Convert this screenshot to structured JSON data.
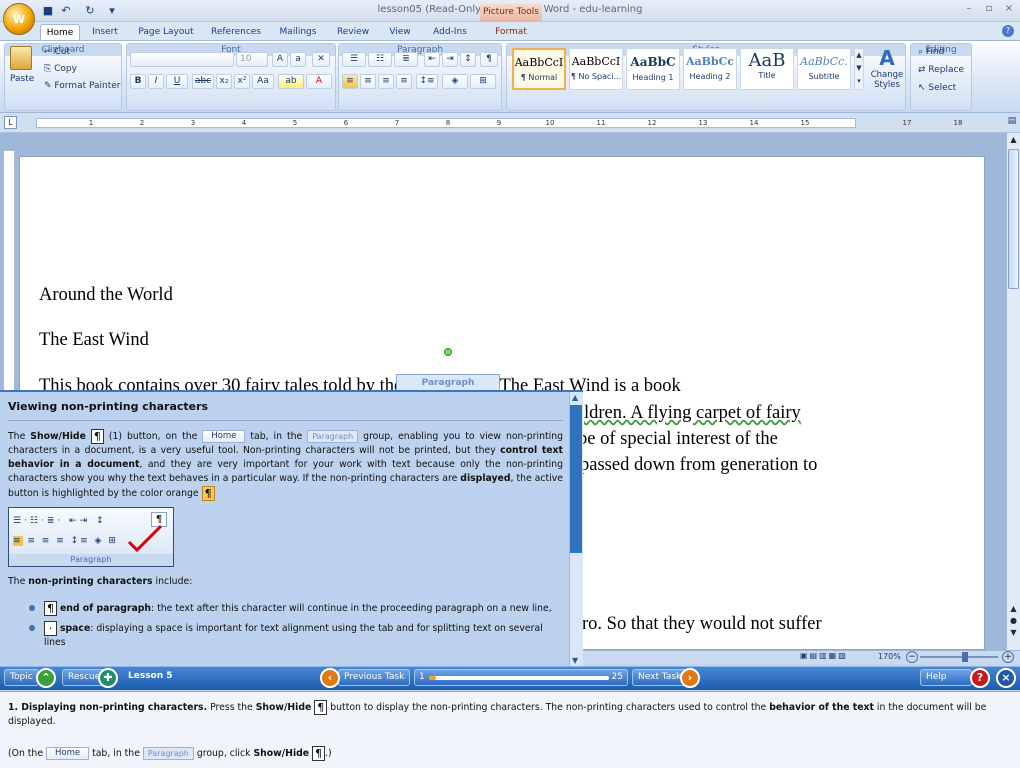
{
  "window": {
    "title": "lesson05 (Read-Only) - Microsoft Word - edu-learning",
    "context_tab": "Picture Tools",
    "office_button": "W"
  },
  "tabs": [
    "Home",
    "Insert",
    "Page Layout",
    "References",
    "Mailings",
    "Review",
    "View",
    "Add-Ins",
    "Format"
  ],
  "ribbon": {
    "clipboard": {
      "label": "Clipboard",
      "paste": "Paste",
      "cut": "Cut",
      "copy": "Copy",
      "format_painter": "Format Painter"
    },
    "font": {
      "label": "Font",
      "size": "10"
    },
    "paragraph": {
      "label": "Paragraph"
    },
    "styles": {
      "label": "Styles",
      "items": [
        {
          "sample": "AaBbCcI",
          "name": "¶ Normal"
        },
        {
          "sample": "AaBbCcI",
          "name": "¶ No Spaci..."
        },
        {
          "sample": "AaBbC",
          "name": "Heading 1"
        },
        {
          "sample": "AaBbCc",
          "name": "Heading 2"
        },
        {
          "sample": "AaB",
          "name": "Title"
        },
        {
          "sample": "AaBbCc.",
          "name": "Subtitle"
        }
      ],
      "change_styles": "Change Styles"
    },
    "editing": {
      "label": "Editing",
      "find": "Find",
      "replace": "Replace",
      "select": "Select"
    }
  },
  "ruler": {
    "ticks": [
      "1",
      "2",
      "3",
      "4",
      "5",
      "6",
      "7",
      "8",
      "9",
      "10",
      "11",
      "12",
      "13",
      "14",
      "15",
      "17",
      "18"
    ]
  },
  "document": {
    "lines": [
      "Around the World",
      "The East Wind",
      "This book contains over 30 fairy tales told by the East Winds. The East Wind is a book",
      "ldren. A flying carpet of fairy",
      "be of special interest of the",
      "passed down from generation to",
      "ro. So that they would not suffer"
    ],
    "float_label": "Paragraph"
  },
  "panel": {
    "title": "Viewing non-printing characters",
    "p1_a": "The ",
    "p1_showhide": "Show/Hide",
    "p1_b": " (1) button, on the ",
    "p1_home": "Home",
    "p1_c": " tab, in the ",
    "p1_paragraph": "Paragraph",
    "p1_d": " group, enabling you to view non-printing characters in a document, is a very useful tool. Non-printing characters will not be printed, but they ",
    "p1_bold1": "control text behavior in a document",
    "p1_e": ", and they are very important for your work with text because only the non-printing characters show you why the text behaves in a particular way. If the non-printing characters are ",
    "p1_bold2": "displayed",
    "p1_f": ", the active button is highlighted by the color orange",
    "mini_label": "Paragraph",
    "p2_a": "The ",
    "p2_bold": "non-printing characters",
    "p2_b": " include:",
    "bullet1_bold": "end of paragraph",
    "bullet1_text": ": the text after this character will continue in the proceeding paragraph on a new line,",
    "bullet2_bold": "space",
    "bullet2_text": ": displaying a space is important for text alignment using the tab and for splitting text on several lines"
  },
  "status": {
    "zoom": "170%"
  },
  "nav": {
    "topic": "Topic",
    "rescue": "Rescue",
    "lesson": "Lesson 5",
    "previous": "Previous Task",
    "current_page": "1",
    "total_pages": "25",
    "progress": 0.04,
    "next": "Next Task",
    "help": "Help"
  },
  "instruction": {
    "step": "1. Displaying non-printing characters.",
    "a": " Press the ",
    "showhide": "Show/Hide",
    "b": " button to display the non-printing characters. The non-printing characters used to control the ",
    "bold": "behavior of the text",
    "c": " in the document will be displayed.",
    "hint_a": "(On the ",
    "hint_home": "Home",
    "hint_b": " tab, in the ",
    "hint_paragraph": "Paragraph",
    "hint_c": " group, click ",
    "hint_showhide": "Show/Hide",
    "hint_d": ".)"
  },
  "colors": {
    "accent": "#1d5cae",
    "highlight": "#f7c65f",
    "panel": "#bcd2ef"
  }
}
